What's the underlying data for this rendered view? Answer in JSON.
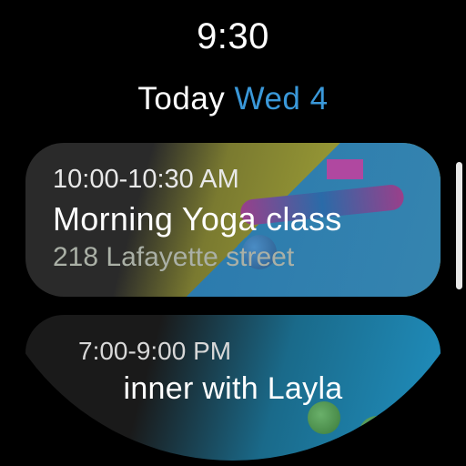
{
  "clock": "9:30",
  "header": {
    "today_label": "Today",
    "day_label": "Wed 4"
  },
  "events": [
    {
      "time": "10:00-10:30 AM",
      "title": "Morning Yoga class",
      "location": "218 Lafayette street"
    },
    {
      "time": "7:00-9:00 PM",
      "title": "inner with Layla"
    }
  ]
}
